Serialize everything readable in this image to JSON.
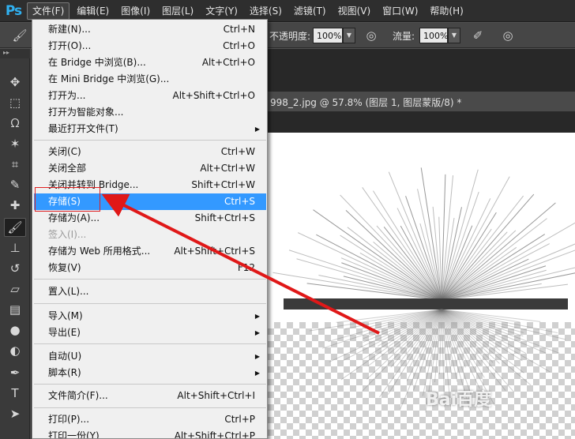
{
  "app": {
    "logo": "Ps",
    "menus": [
      "文件(F)",
      "编辑(E)",
      "图像(I)",
      "图层(L)",
      "文字(Y)",
      "选择(S)",
      "滤镜(T)",
      "视图(V)",
      "窗口(W)",
      "帮助(H)"
    ]
  },
  "options": {
    "opacity_label": "不透明度:",
    "opacity_value": "100%",
    "flow_label": "流量:",
    "flow_value": "100%"
  },
  "document": {
    "tab_title": "998_2.jpg @ 57.8% (图层 1, 图层蒙版/8) *"
  },
  "watermark": "Bai百度",
  "file_menu": [
    {
      "label": "新建(N)...",
      "shortcut": "Ctrl+N"
    },
    {
      "label": "打开(O)...",
      "shortcut": "Ctrl+O"
    },
    {
      "label": "在 Bridge 中浏览(B)...",
      "shortcut": "Alt+Ctrl+O"
    },
    {
      "label": "在 Mini Bridge 中浏览(G)...",
      "shortcut": ""
    },
    {
      "label": "打开为...",
      "shortcut": "Alt+Shift+Ctrl+O"
    },
    {
      "label": "打开为智能对象...",
      "shortcut": ""
    },
    {
      "label": "最近打开文件(T)",
      "shortcut": ""
    },
    {
      "label": "关闭(C)",
      "shortcut": "Ctrl+W"
    },
    {
      "label": "关闭全部",
      "shortcut": "Alt+Ctrl+W"
    },
    {
      "label": "关闭并转到 Bridge...",
      "shortcut": "Shift+Ctrl+W"
    },
    {
      "label": "存储(S)",
      "shortcut": "Ctrl+S"
    },
    {
      "label": "存储为(A)...",
      "shortcut": "Shift+Ctrl+S"
    },
    {
      "label": "签入(I)...",
      "shortcut": ""
    },
    {
      "label": "存储为 Web 所用格式...",
      "shortcut": "Alt+Shift+Ctrl+S"
    },
    {
      "label": "恢复(V)",
      "shortcut": "F12"
    },
    {
      "label": "置入(L)...",
      "shortcut": ""
    },
    {
      "label": "导入(M)",
      "shortcut": ""
    },
    {
      "label": "导出(E)",
      "shortcut": ""
    },
    {
      "label": "自动(U)",
      "shortcut": ""
    },
    {
      "label": "脚本(R)",
      "shortcut": ""
    },
    {
      "label": "文件简介(F)...",
      "shortcut": "Alt+Shift+Ctrl+I"
    },
    {
      "label": "打印(P)...",
      "shortcut": "Ctrl+P"
    },
    {
      "label": "打印一份(Y)",
      "shortcut": "Alt+Shift+Ctrl+P"
    }
  ]
}
